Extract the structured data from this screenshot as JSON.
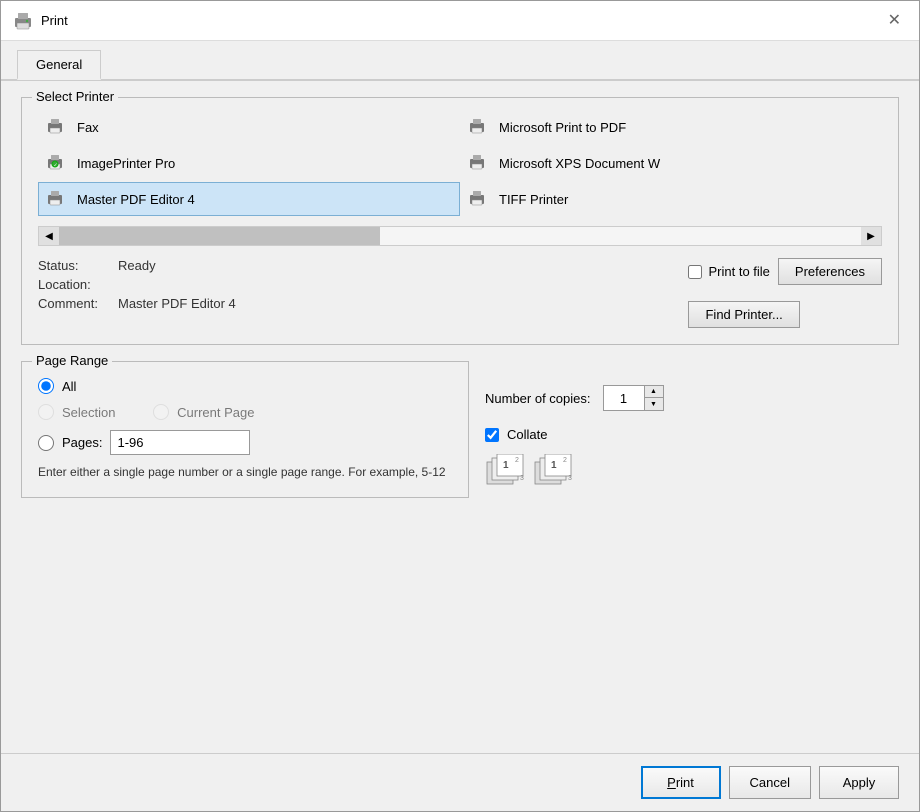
{
  "dialog": {
    "title": "Print",
    "close_label": "✕"
  },
  "tabs": [
    {
      "id": "general",
      "label": "General",
      "active": true
    }
  ],
  "select_printer": {
    "label": "Select Printer",
    "printers": [
      {
        "id": "fax",
        "name": "Fax",
        "selected": false
      },
      {
        "id": "ms-pdf",
        "name": "Microsoft Print to PDF",
        "selected": false
      },
      {
        "id": "imageprinter",
        "name": "ImagePrinter Pro",
        "selected": false
      },
      {
        "id": "ms-xps",
        "name": "Microsoft XPS Document W",
        "selected": false
      },
      {
        "id": "master-pdf",
        "name": "Master PDF Editor 4",
        "selected": true
      },
      {
        "id": "tiff",
        "name": "TIFF Printer",
        "selected": false
      }
    ]
  },
  "printer_info": {
    "status_label": "Status:",
    "status_value": "Ready",
    "location_label": "Location:",
    "location_value": "",
    "comment_label": "Comment:",
    "comment_value": "Master PDF Editor 4"
  },
  "print_to_file": {
    "label": "Print to file",
    "checked": false
  },
  "buttons": {
    "preferences": "Preferences",
    "find_printer": "Find Printer..."
  },
  "page_range": {
    "label": "Page Range",
    "options": [
      {
        "id": "all",
        "label": "All",
        "selected": true
      },
      {
        "id": "selection",
        "label": "Selection",
        "selected": false,
        "disabled": true
      },
      {
        "id": "current",
        "label": "Current Page",
        "selected": false,
        "disabled": true
      },
      {
        "id": "pages",
        "label": "Pages:",
        "selected": false
      }
    ],
    "pages_value": "1-96",
    "hint": "Enter either a single page number or a\nsingle page range.  For example, 5-12"
  },
  "copies": {
    "label": "Number of copies:",
    "value": "1"
  },
  "collate": {
    "label": "Collate",
    "checked": true
  },
  "footer": {
    "print_label": "Print",
    "cancel_label": "Cancel",
    "apply_label": "Apply"
  }
}
